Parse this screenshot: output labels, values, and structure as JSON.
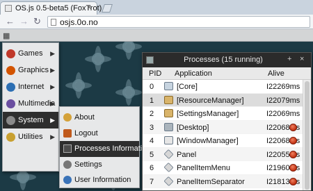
{
  "browser": {
    "tab_title": "OS.js 0.5-beta5 (FoxTrot)",
    "tab_close": "×",
    "url": "osjs.0o.no",
    "back_glyph": "←",
    "forward_glyph": "→",
    "reload_glyph": "↻"
  },
  "desktop": {
    "launcher_glyph": "▦"
  },
  "main_menu": {
    "items": [
      {
        "label": "Games",
        "icon": "games-icon",
        "color": "#c0392b"
      },
      {
        "label": "Graphics",
        "icon": "graphics-icon",
        "color": "#d35400"
      },
      {
        "label": "Internet",
        "icon": "internet-icon",
        "color": "#2c6fb3"
      },
      {
        "label": "Multimedia",
        "icon": "multimedia-icon",
        "color": "#6a4ea0"
      },
      {
        "label": "System",
        "icon": "system-icon",
        "color": "#5b5b5b"
      },
      {
        "label": "Utilities",
        "icon": "utilities-icon",
        "color": "#c8a030"
      }
    ],
    "arrow": "▶",
    "active_index": 4
  },
  "system_menu": {
    "items": [
      {
        "label": "About",
        "icon": "about-icon"
      },
      {
        "label": "Logout",
        "icon": "logout-icon"
      },
      {
        "label": "Processes Information",
        "icon": "processes-icon"
      },
      {
        "label": "Settings",
        "icon": "settings-icon"
      },
      {
        "label": "User Information",
        "icon": "user-icon"
      }
    ],
    "active_index": 2
  },
  "process_window": {
    "title": "Processes (15 running)",
    "minimize_glyph": "+",
    "close_glyph": "×",
    "columns": {
      "pid": "PID",
      "application": "Application",
      "alive": "Alive"
    },
    "rows": [
      {
        "pid": "0",
        "name": "[Core]",
        "alive": "I22269ms",
        "killable": false
      },
      {
        "pid": "1",
        "name": "[ResourceManager]",
        "alive": "I22079ms",
        "killable": false
      },
      {
        "pid": "2",
        "name": "[SettingsManager]",
        "alive": "I22069ms",
        "killable": false
      },
      {
        "pid": "3",
        "name": "[Desktop]",
        "alive": "I22068ms",
        "killable": true
      },
      {
        "pid": "4",
        "name": "[WindowManager]",
        "alive": "I22068ms",
        "killable": true
      },
      {
        "pid": "5",
        "name": "Panel",
        "alive": "I22055ms",
        "killable": true
      },
      {
        "pid": "6",
        "name": "PanelItemMenu",
        "alive": "I21960ms",
        "killable": true
      },
      {
        "pid": "7",
        "name": "PanelItemSeparator",
        "alive": "I21813ms",
        "killable": true
      }
    ]
  }
}
